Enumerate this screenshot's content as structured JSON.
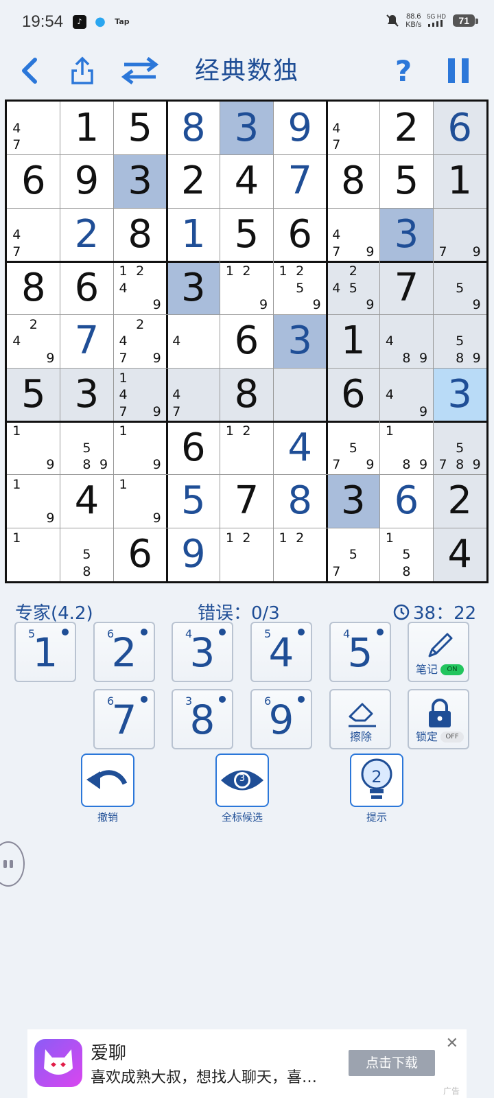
{
  "status": {
    "time": "19:54",
    "net_speed_value": "88.6",
    "net_speed_unit": "KB/s",
    "network": "5G HD",
    "battery": "71",
    "app_icons": [
      "tiktok-icon",
      "qq-icon",
      "taptap-icon"
    ],
    "tap_label": "Tap"
  },
  "header": {
    "title": "经典数独",
    "back_icon": "back-icon",
    "share_icon": "share-icon",
    "switch_icon": "switch-icon",
    "help_label": "?",
    "pause_icon": "pause-icon"
  },
  "board": {
    "rows": [
      [
        {
          "n": "47"
        },
        {
          "v": "1",
          "g": 1
        },
        {
          "v": "5",
          "g": 1
        },
        {
          "v": "8",
          "g": 0
        },
        {
          "v": "3",
          "g": 0,
          "hl": "strong"
        },
        {
          "v": "9",
          "g": 0
        },
        {
          "n": "47"
        },
        {
          "v": "2",
          "g": 1
        },
        {
          "v": "6",
          "g": 0,
          "hl": "light"
        }
      ],
      [
        {
          "v": "6",
          "g": 1
        },
        {
          "v": "9",
          "g": 1
        },
        {
          "v": "3",
          "g": 1,
          "hl": "strong"
        },
        {
          "v": "2",
          "g": 1
        },
        {
          "v": "4",
          "g": 1
        },
        {
          "v": "7",
          "g": 0
        },
        {
          "v": "8",
          "g": 1
        },
        {
          "v": "5",
          "g": 1
        },
        {
          "v": "1",
          "g": 1,
          "hl": "light"
        }
      ],
      [
        {
          "n": "47"
        },
        {
          "v": "2",
          "g": 0
        },
        {
          "v": "8",
          "g": 1
        },
        {
          "v": "1",
          "g": 0
        },
        {
          "v": "5",
          "g": 1
        },
        {
          "v": "6",
          "g": 1
        },
        {
          "n": "479"
        },
        {
          "v": "3",
          "g": 0,
          "hl": "strong"
        },
        {
          "n": "79",
          "hl": "light"
        }
      ],
      [
        {
          "v": "8",
          "g": 1
        },
        {
          "v": "6",
          "g": 1
        },
        {
          "n": "1249"
        },
        {
          "v": "3",
          "g": 1,
          "hl": "strong"
        },
        {
          "n": "129"
        },
        {
          "n": "1259"
        },
        {
          "n": "2459",
          "hl": "light"
        },
        {
          "v": "7",
          "g": 1,
          "hl": "light"
        },
        {
          "n": "59",
          "hl": "light"
        }
      ],
      [
        {
          "n": "249"
        },
        {
          "v": "7",
          "g": 0
        },
        {
          "n": "2479"
        },
        {
          "n": "4"
        },
        {
          "v": "6",
          "g": 1
        },
        {
          "v": "3",
          "g": 0,
          "hl": "strong"
        },
        {
          "v": "1",
          "g": 1,
          "hl": "light"
        },
        {
          "n": "489",
          "hl": "light"
        },
        {
          "n": "589",
          "hl": "light"
        }
      ],
      [
        {
          "v": "5",
          "g": 1,
          "hl": "light"
        },
        {
          "v": "3",
          "g": 1,
          "hl": "light"
        },
        {
          "n": "1479",
          "hl": "light"
        },
        {
          "n": "47",
          "hl": "light"
        },
        {
          "v": "8",
          "g": 1,
          "hl": "light"
        },
        {
          "n": "",
          "hl": "light"
        },
        {
          "v": "6",
          "g": 1,
          "hl": "light"
        },
        {
          "n": "49",
          "hl": "light"
        },
        {
          "v": "3",
          "g": 0,
          "hl": "sel"
        }
      ],
      [
        {
          "n": "19"
        },
        {
          "n": "589"
        },
        {
          "n": "19"
        },
        {
          "v": "6",
          "g": 1
        },
        {
          "n": "12"
        },
        {
          "v": "4",
          "g": 0
        },
        {
          "n": "579"
        },
        {
          "n": "189"
        },
        {
          "n": "5789",
          "hl": "light"
        }
      ],
      [
        {
          "n": "19"
        },
        {
          "v": "4",
          "g": 1
        },
        {
          "n": "19"
        },
        {
          "v": "5",
          "g": 0
        },
        {
          "v": "7",
          "g": 1
        },
        {
          "v": "8",
          "g": 0
        },
        {
          "v": "3",
          "g": 1,
          "hl": "strong"
        },
        {
          "v": "6",
          "g": 0
        },
        {
          "v": "2",
          "g": 1,
          "hl": "light"
        }
      ],
      [
        {
          "n": "1"
        },
        {
          "n": "58"
        },
        {
          "v": "6",
          "g": 1
        },
        {
          "v": "9",
          "g": 0
        },
        {
          "n": "12"
        },
        {
          "n": "12"
        },
        {
          "n": "57"
        },
        {
          "n": "158"
        },
        {
          "v": "4",
          "g": 1,
          "hl": "light"
        }
      ]
    ]
  },
  "info": {
    "difficulty": "专家(4.2)",
    "mistakes": "错误：0/3",
    "timer": "38：22",
    "clock_icon": "clock-icon"
  },
  "keypad": {
    "digits": [
      {
        "num": "1",
        "count": "5"
      },
      {
        "num": "2",
        "count": "6"
      },
      {
        "num": "3",
        "count": "4"
      },
      {
        "num": "4",
        "count": "5"
      },
      {
        "num": "5",
        "count": "4"
      },
      {
        "num": "7",
        "count": "6"
      },
      {
        "num": "8",
        "count": "3"
      },
      {
        "num": "9",
        "count": "6"
      }
    ],
    "notes_label": "笔记",
    "notes_toggle": "ON",
    "erase_label": "擦除",
    "lock_label": "锁定",
    "lock_toggle": "OFF"
  },
  "actions": {
    "undo_label": "撤销",
    "mark_all_label": "全标候选",
    "mark_all_count": "3",
    "hint_label": "提示",
    "hint_count": "2"
  },
  "ad": {
    "app_name": "爱聊",
    "text": "喜欢成熟大叔，想找人聊天，喜…",
    "button": "点击下载",
    "badge": "广告"
  },
  "colors": {
    "accent": "#1f4e96",
    "highlight_strong": "#a9bddb",
    "highlight_light": "#e1e6ed",
    "selected": "#b9dbf7"
  }
}
